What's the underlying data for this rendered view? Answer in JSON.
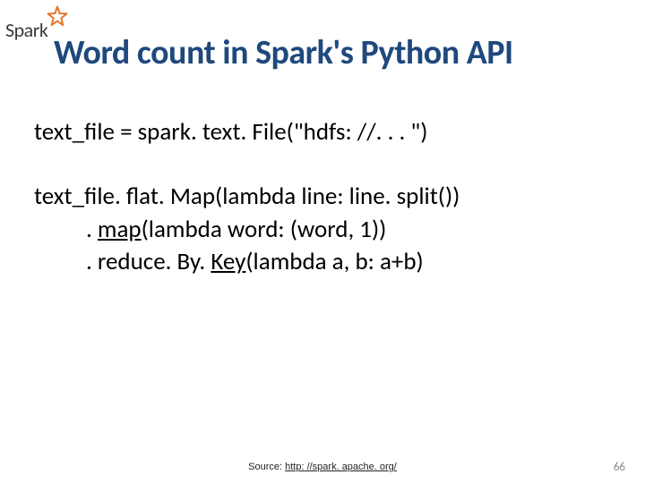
{
  "logo": {
    "text": "Spark"
  },
  "title": "Word count in Spark's Python API",
  "code": {
    "l1": "text_file = spark. text. File(\"hdfs: //. . . \")",
    "l2": "text_file. flat. Map(lambda line: line. split())",
    "l3a": ". ",
    "l3b": "map",
    "l3c": "(lambda word: (word, 1))",
    "l4a": ". reduce. By. ",
    "l4b": "Key",
    "l4c": "(lambda a, b: a+b)"
  },
  "footer": {
    "label": "Source: ",
    "link_text": "http: //spark. apache. org/",
    "link_href": "http://spark.apache.org/"
  },
  "page_number": "66"
}
